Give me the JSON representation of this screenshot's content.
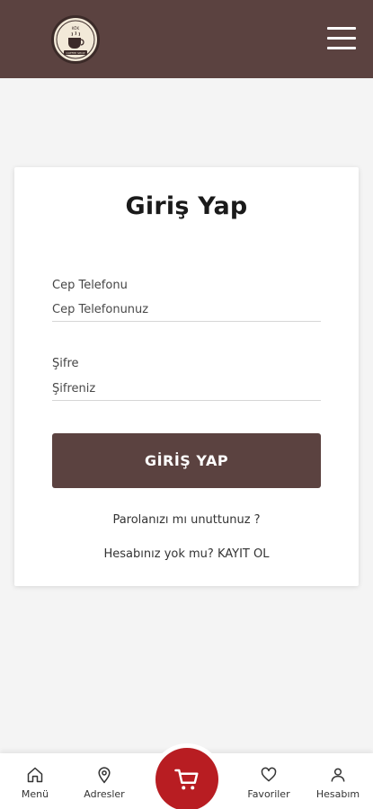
{
  "header": {
    "logo_text": "KÖK COFFEE SHOP",
    "menu_icon": "hamburger-menu-icon"
  },
  "login": {
    "title": "Giriş Yap",
    "phone_label": "Cep Telefonu",
    "phone_placeholder": "Cep Telefonunuz",
    "password_label": "Şifre",
    "password_placeholder": "Şifreniz",
    "submit_label": "GİRİŞ YAP",
    "forgot_label": "Parolanızı mı unuttunuz ?",
    "register_prompt": "Hesabınız yok mu?",
    "register_link": "KAYIT OL"
  },
  "nav": {
    "items": [
      {
        "label": "Menü",
        "icon": "home-icon"
      },
      {
        "label": "Adresler",
        "icon": "location-pin-icon"
      },
      {
        "label": "Favoriler",
        "icon": "heart-icon"
      },
      {
        "label": "Hesabım",
        "icon": "user-icon"
      }
    ],
    "cart_icon": "cart-icon"
  },
  "colors": {
    "brand_brown": "#5b4240",
    "cart_red": "#b81d22",
    "background": "#f4f4f4"
  }
}
